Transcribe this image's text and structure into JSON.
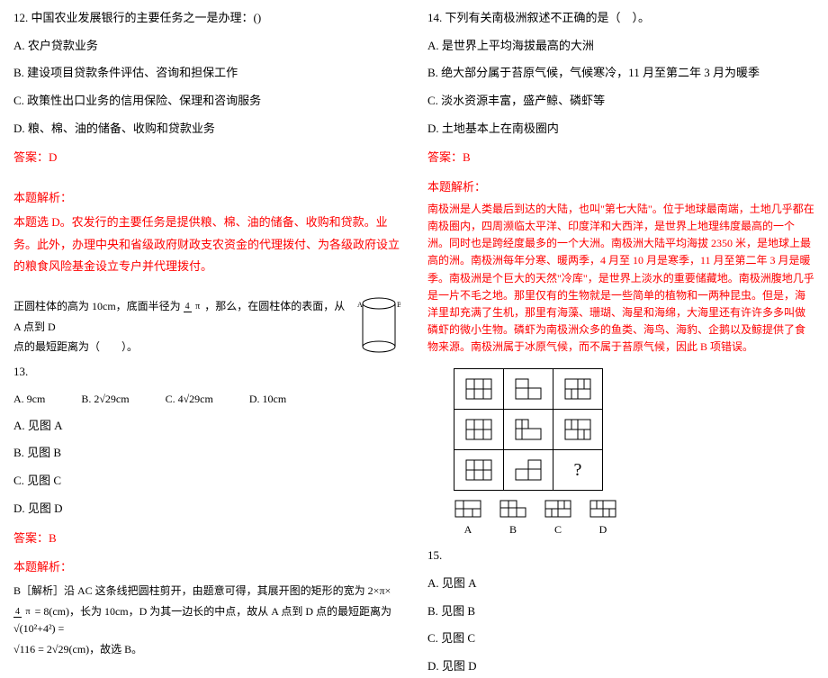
{
  "left": {
    "q12": {
      "stem": "12. 中国农业发展银行的主要任务之一是办理：()",
      "A": "A. 农户贷款业务",
      "B": "B. 建设项目贷款条件评估、咨询和担保工作",
      "C": "C. 政策性出口业务的信用保险、保理和咨询服务",
      "D": "D. 粮、棉、油的储备、收购和贷款业务",
      "answer": "答案：D",
      "explain_label": "本题解析：",
      "explain_body": "本题选 D。农发行的主要任务是提供粮、棉、油的储备、收购和贷款。业务。此外，办理中央和省级政府财政支农资金的代理拨付、为各级政府设立的粮食风险基金设立专户并代理拨付。"
    },
    "q13": {
      "fig_prefix": "正圆柱体的高为 10cm，底面半径为",
      "fig_suffix": "，那么，在圆柱体的表面，从 A 点到 D",
      "fig_line2": "点的最短距离为（　　）。",
      "num": "13.",
      "optA": "A. 9cm",
      "optB": "B. 2√29cm",
      "optC": "C. 4√29cm",
      "optD": "D. 10cm",
      "A": "A. 见图 A",
      "B": "B. 见图 B",
      "C": "C. 见图 C",
      "D": "D. 见图 D",
      "answer": "答案：B",
      "explain_label": "本题解析：",
      "explain_body1": "B［解析］沿 AC 这条线把圆柱剪开，由题意可得，其展开图的矩形的宽为 2×π×",
      "explain_body2": "= 8(cm)，长为 10cm，D 为其一边长的中点，故从 A 点到 D 点的最短距离为 √(10²+4²) =",
      "explain_body3": "√116 = 2√29(cm)，故选 B。",
      "labelA": "A",
      "labelB": "B",
      "frac_n": "4",
      "frac_d": "π"
    }
  },
  "right": {
    "q14": {
      "stem": "14. 下列有关南极洲叙述不正确的是（　）。",
      "A": "A. 是世界上平均海拔最高的大洲",
      "B": "B. 绝大部分属于苔原气候，气候寒冷，11 月至第二年 3 月为暖季",
      "C": "C. 淡水资源丰富，盛产鲸、磷虾等",
      "D": "D. 土地基本上在南极圈内",
      "answer": "答案：B",
      "explain_label": "本题解析：",
      "explain_body": "南极洲是人类最后到达的大陆，也叫\"第七大陆\"。位于地球最南端，土地几乎都在南极圈内，四周濒临太平洋、印度洋和大西洋，是世界上地理纬度最高的一个洲。同时也是跨经度最多的一个大洲。南极洲大陆平均海拔 2350 米，是地球上最高的洲。南极洲每年分寒、暖两季，4 月至 10 月是寒季，11 月至第二年 3 月是暖季。南极洲是个巨大的天然\"冷库\"，是世界上淡水的重要储藏地。南极洲腹地几乎是一片不毛之地。那里仅有的生物就是一些简单的植物和一两种昆虫。但是，海洋里却充满了生机，那里有海藻、珊瑚、海星和海绵，大海里还有许许多多叫做磷虾的微小生物。磷虾为南极洲众多的鱼类、海鸟、海豹、企鹅以及鲸提供了食物来源。南极洲属于冰原气候，而不属于苔原气候，因此 B 项错误。"
    },
    "q15": {
      "num": "15.",
      "A": "A. 见图 A",
      "B": "B. 见图 B",
      "C": "C. 见图 C",
      "D": "D. 见图 D",
      "labelA": "A",
      "labelB": "B",
      "labelC": "C",
      "labelD": "D",
      "qmark": "?"
    }
  }
}
